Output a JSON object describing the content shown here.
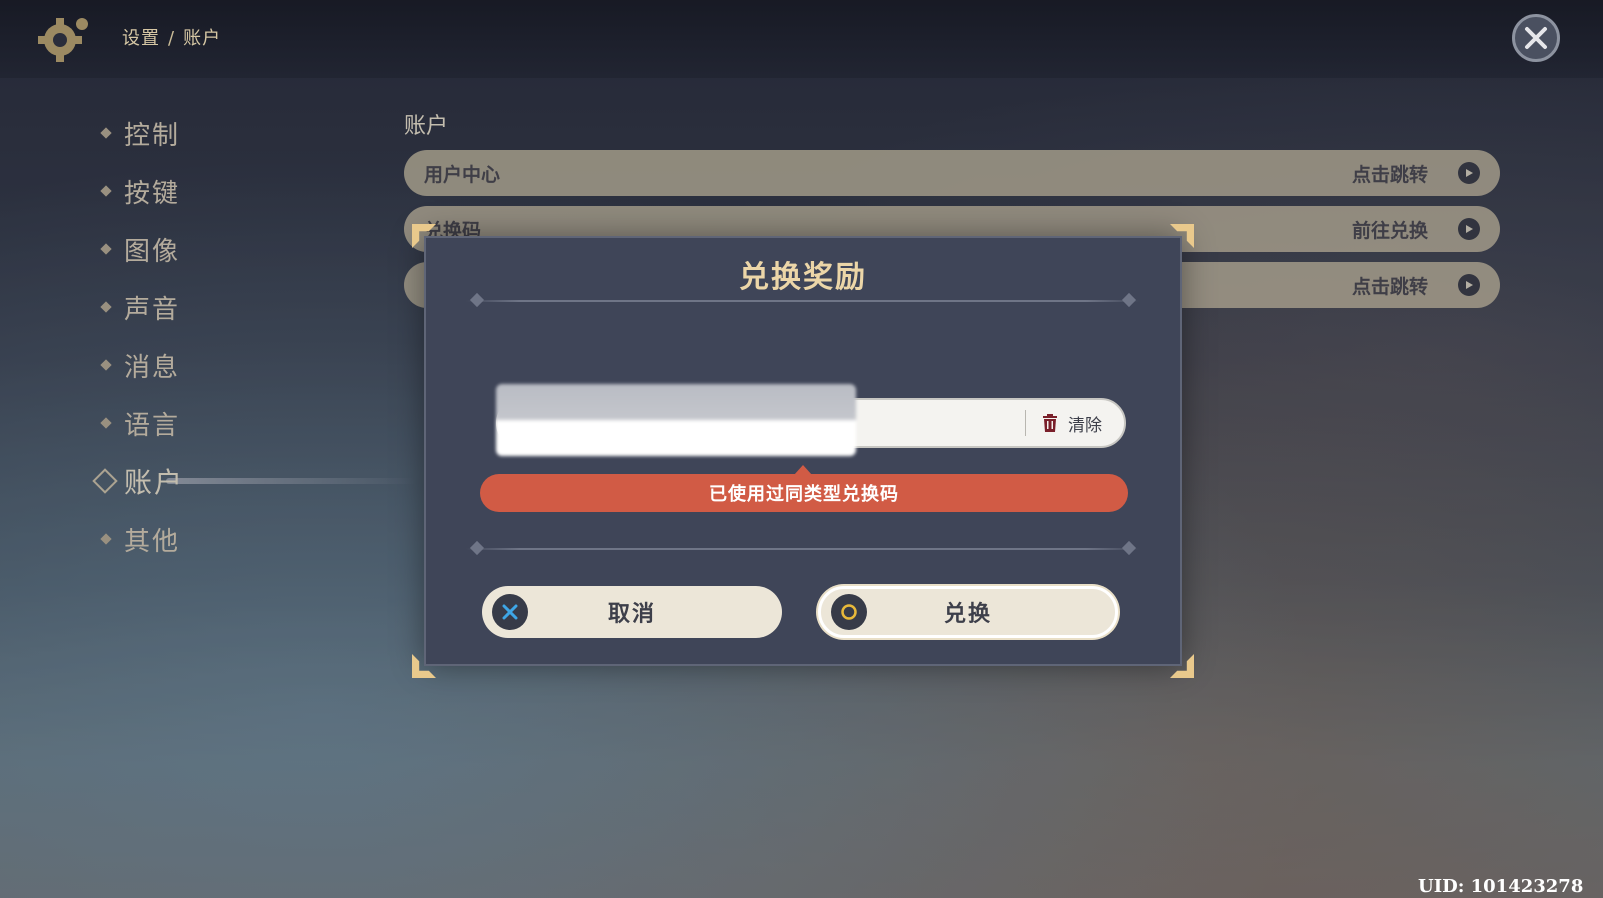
{
  "breadcrumb": {
    "parent": "设置",
    "separator": "/",
    "current": "账户"
  },
  "sidebar": {
    "items": [
      {
        "label": "控制"
      },
      {
        "label": "按键"
      },
      {
        "label": "图像"
      },
      {
        "label": "声音"
      },
      {
        "label": "消息"
      },
      {
        "label": "语言"
      },
      {
        "label": "账户",
        "active": true
      },
      {
        "label": "其他"
      }
    ]
  },
  "main": {
    "section_title": "账户",
    "rows": [
      {
        "label": "用户中心",
        "action": "点击跳转"
      },
      {
        "label": "兑换码",
        "action": "前往兑换"
      },
      {
        "label": "",
        "action": "点击跳转"
      }
    ]
  },
  "dialog": {
    "title": "兑换奖励",
    "input_value": "",
    "clear_label": "清除",
    "error": "已使用过同类型兑换码",
    "cancel_label": "取消",
    "confirm_label": "兑换"
  },
  "footer": {
    "uid": "UID: 101423278"
  },
  "icons": {
    "settings": "gear-icon",
    "close": "close-icon",
    "arrow": "arrow-right-icon",
    "trash": "trash-icon",
    "cancel": "cross-icon",
    "confirm": "circle-icon"
  },
  "colors": {
    "accent": "#ecd6a8",
    "error": "#d15b45",
    "panel": "#3f4558"
  }
}
